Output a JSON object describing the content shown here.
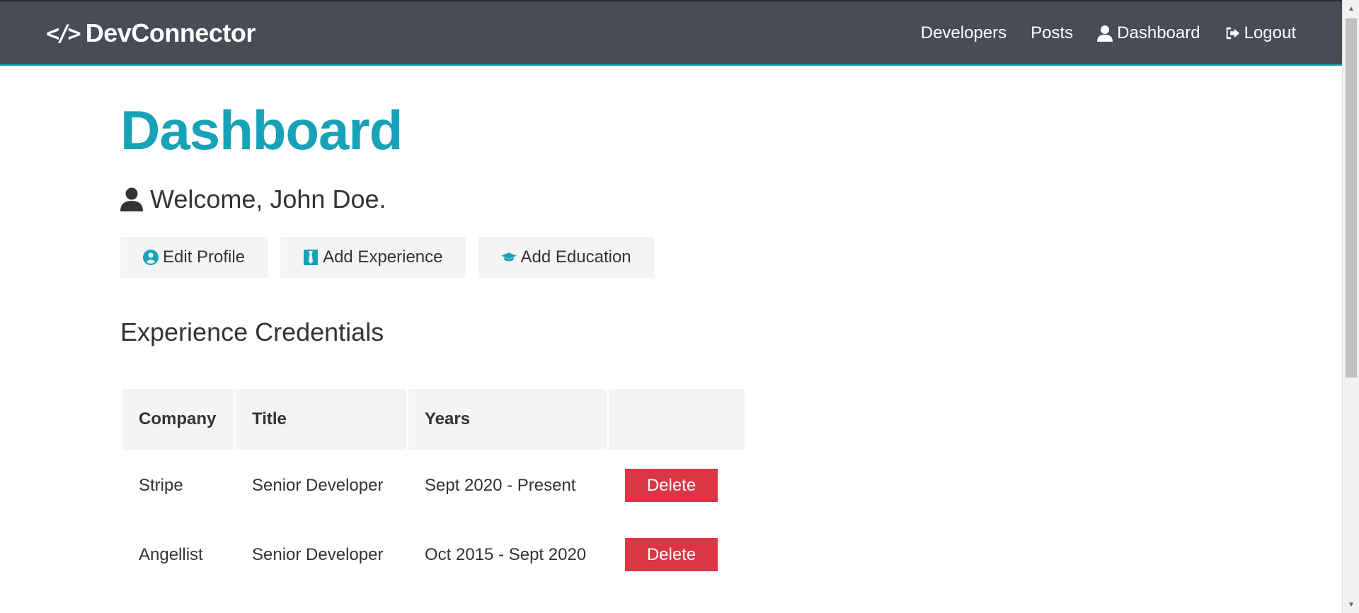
{
  "navbar": {
    "brand": "DevConnector",
    "brand_icon": "code-icon",
    "links": [
      {
        "label": "Developers"
      },
      {
        "label": "Posts"
      },
      {
        "label": "Dashboard",
        "icon": "user-icon"
      },
      {
        "label": "Logout",
        "icon": "sign-out-icon"
      }
    ]
  },
  "page": {
    "title": "Dashboard",
    "welcome": "Welcome, John Doe."
  },
  "actions": [
    {
      "label": "Edit Profile",
      "icon": "user-circle-icon"
    },
    {
      "label": "Add Experience",
      "icon": "tie-icon"
    },
    {
      "label": "Add Education",
      "icon": "graduation-cap-icon"
    }
  ],
  "experience": {
    "title": "Experience Credentials",
    "headers": [
      "Company",
      "Title",
      "Years",
      ""
    ],
    "rows": [
      {
        "company": "Stripe",
        "title": "Senior Developer",
        "years": "Sept 2020 - Present",
        "action": "Delete"
      },
      {
        "company": "Angellist",
        "title": "Senior Developer",
        "years": "Oct 2015 - Sept 2020",
        "action": "Delete"
      }
    ]
  },
  "colors": {
    "primary": "#17a2b8",
    "navbar": "#474c55",
    "danger": "#dc3545",
    "light": "#f4f4f4"
  }
}
